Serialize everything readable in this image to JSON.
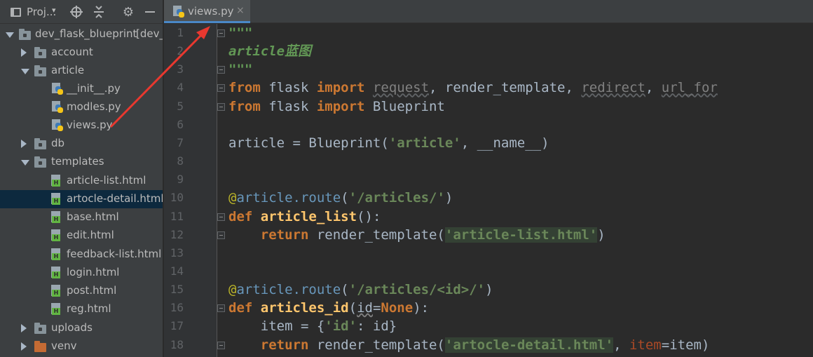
{
  "project_panel": {
    "title": "Proj...",
    "dropdown": "▾",
    "tree": [
      {
        "label": "dev_flask_blueprint",
        "suffix": " [dev_",
        "type": "folder",
        "expanded": true,
        "level": 0
      },
      {
        "label": "account",
        "type": "folder",
        "expanded": false,
        "level": 1
      },
      {
        "label": "article",
        "type": "folder",
        "expanded": true,
        "level": 1
      },
      {
        "label": "__init__.py",
        "type": "py",
        "level": 2
      },
      {
        "label": "modles.py",
        "type": "py",
        "level": 2
      },
      {
        "label": "views.py",
        "type": "py",
        "level": 2
      },
      {
        "label": "db",
        "type": "folder",
        "expanded": false,
        "level": 1
      },
      {
        "label": "templates",
        "type": "folder",
        "expanded": true,
        "level": 1
      },
      {
        "label": "article-list.html",
        "type": "html",
        "level": 2
      },
      {
        "label": "artocle-detail.html",
        "type": "html",
        "level": 2,
        "selected": true
      },
      {
        "label": "base.html",
        "type": "html",
        "level": 2
      },
      {
        "label": "edit.html",
        "type": "html",
        "level": 2
      },
      {
        "label": "feedback-list.html",
        "type": "html",
        "level": 2
      },
      {
        "label": "login.html",
        "type": "html",
        "level": 2
      },
      {
        "label": "post.html",
        "type": "html",
        "level": 2
      },
      {
        "label": "reg.html",
        "type": "html",
        "level": 2
      },
      {
        "label": "uploads",
        "type": "folder",
        "expanded": false,
        "level": 1
      },
      {
        "label": "venv",
        "type": "folder-orange",
        "expanded": false,
        "level": 1
      }
    ]
  },
  "editor": {
    "tab": {
      "label": "views.py",
      "close": "×"
    },
    "line_numbers": [
      "1",
      "2",
      "3",
      "4",
      "5",
      "6",
      "7",
      "8",
      "9",
      "10",
      "11",
      "12",
      "13",
      "14",
      "15",
      "16",
      "17",
      "18"
    ],
    "lines": [
      [
        [
          "doc",
          "\"\"\""
        ]
      ],
      [
        [
          "doc",
          "article蓝图"
        ]
      ],
      [
        [
          "doc",
          "\"\"\""
        ]
      ],
      [
        [
          "kw",
          "from"
        ],
        [
          "pl",
          " flask "
        ],
        [
          "kw",
          "import"
        ],
        [
          "pl",
          " "
        ],
        [
          "gray",
          "request"
        ],
        [
          "pl",
          ", render_template, "
        ],
        [
          "gray",
          "redirect"
        ],
        [
          "pl",
          ", "
        ],
        [
          "gray",
          "url_for"
        ]
      ],
      [
        [
          "kw",
          "from"
        ],
        [
          "pl",
          " flask "
        ],
        [
          "kw",
          "import"
        ],
        [
          "pl",
          " Blueprint"
        ]
      ],
      [],
      [
        [
          "pl",
          "article = Blueprint("
        ],
        [
          "str",
          "'article'"
        ],
        [
          "pl",
          ", __name__)"
        ]
      ],
      [],
      [],
      [
        [
          "deco",
          "@"
        ],
        [
          "rgb",
          "article.route"
        ],
        [
          "pl",
          "("
        ],
        [
          "str",
          "'/articles/'"
        ],
        [
          "pl",
          ")"
        ]
      ],
      [
        [
          "kw",
          "def"
        ],
        [
          "pl",
          " "
        ],
        [
          "fn",
          "article_list"
        ],
        [
          "pl",
          "():"
        ]
      ],
      [
        [
          "pl",
          "    "
        ],
        [
          "kw",
          "return"
        ],
        [
          "pl",
          " render_template("
        ],
        [
          "strh",
          "'article-list.html'"
        ],
        [
          "pl",
          ")"
        ]
      ],
      [],
      [],
      [
        [
          "deco",
          "@"
        ],
        [
          "rgb",
          "article.route"
        ],
        [
          "pl",
          "("
        ],
        [
          "str",
          "'/articles/<id>/'"
        ],
        [
          "pl",
          ")"
        ]
      ],
      [
        [
          "kw",
          "def"
        ],
        [
          "pl",
          " "
        ],
        [
          "fn",
          "articles_id"
        ],
        [
          "pl",
          "("
        ],
        [
          "param",
          "id"
        ],
        [
          "pl",
          "="
        ],
        [
          "none",
          "None"
        ],
        [
          "pl",
          "):"
        ]
      ],
      [
        [
          "pl",
          "    item = {"
        ],
        [
          "str",
          "'id'"
        ],
        [
          "pl",
          ": id}"
        ]
      ],
      [
        [
          "pl",
          "    "
        ],
        [
          "kw",
          "return"
        ],
        [
          "pl",
          " render_template("
        ],
        [
          "strh",
          "'artocle-detail.html'"
        ],
        [
          "pl",
          ", "
        ],
        [
          "kwarg",
          "item"
        ],
        [
          "pl",
          "=item)"
        ]
      ]
    ]
  },
  "colors": {
    "annotation_arrow": "#e8382f",
    "selection": "#0d293e",
    "tab_underline": "#4a88c7"
  }
}
